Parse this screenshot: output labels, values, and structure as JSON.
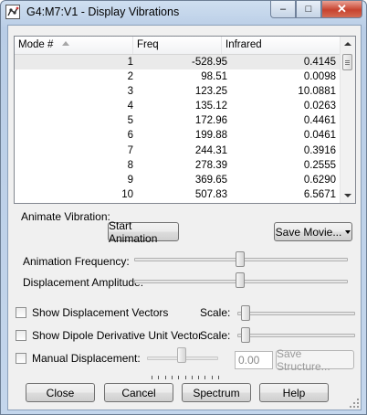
{
  "window": {
    "title": "G4:M7:V1 - Display Vibrations",
    "app_icon": "gaussview-molecule-icon",
    "controls": {
      "minimize": "–",
      "maximize": "□",
      "close": "✕"
    }
  },
  "table": {
    "columns": [
      "Mode #",
      "Freq",
      "Infrared"
    ],
    "sort_icon": "sort-ascending-icon",
    "selected_row": 0,
    "rows": [
      {
        "mode": "1",
        "freq": "-528.95",
        "ir": "0.4145"
      },
      {
        "mode": "2",
        "freq": "98.51",
        "ir": "0.0098"
      },
      {
        "mode": "3",
        "freq": "123.25",
        "ir": "10.0881"
      },
      {
        "mode": "4",
        "freq": "135.12",
        "ir": "0.0263"
      },
      {
        "mode": "5",
        "freq": "172.96",
        "ir": "0.4461"
      },
      {
        "mode": "6",
        "freq": "199.88",
        "ir": "0.0461"
      },
      {
        "mode": "7",
        "freq": "244.31",
        "ir": "0.3916"
      },
      {
        "mode": "8",
        "freq": "278.39",
        "ir": "0.2555"
      },
      {
        "mode": "9",
        "freq": "369.65",
        "ir": "0.6290"
      },
      {
        "mode": "10",
        "freq": "507.83",
        "ir": "6.5671"
      }
    ]
  },
  "animate": {
    "section_label": "Animate Vibration:",
    "start_button": "Start Animation",
    "save_movie_button": "Save Movie...",
    "frequency_label": "Animation Frequency:",
    "frequency_level": 0.5,
    "amplitude_label": "Displacement Amplitude:",
    "amplitude_level": 0.5
  },
  "options": {
    "show_vectors_label": "Show Displacement Vectors",
    "show_vectors_checked": false,
    "vectors_scale_label": "Scale:",
    "vectors_scale_level": 0.0,
    "show_dipole_label": "Show Dipole Derivative Unit Vector",
    "show_dipole_checked": false,
    "dipole_scale_label": "Scale:",
    "dipole_scale_level": 0.0,
    "manual_label": "Manual Displacement:",
    "manual_checked": false,
    "manual_level": 0.5,
    "manual_value": "0.00",
    "save_structure_button": "Save Structure..."
  },
  "footer": {
    "close": "Close",
    "cancel": "Cancel",
    "spectrum": "Spectrum",
    "help": "Help"
  }
}
